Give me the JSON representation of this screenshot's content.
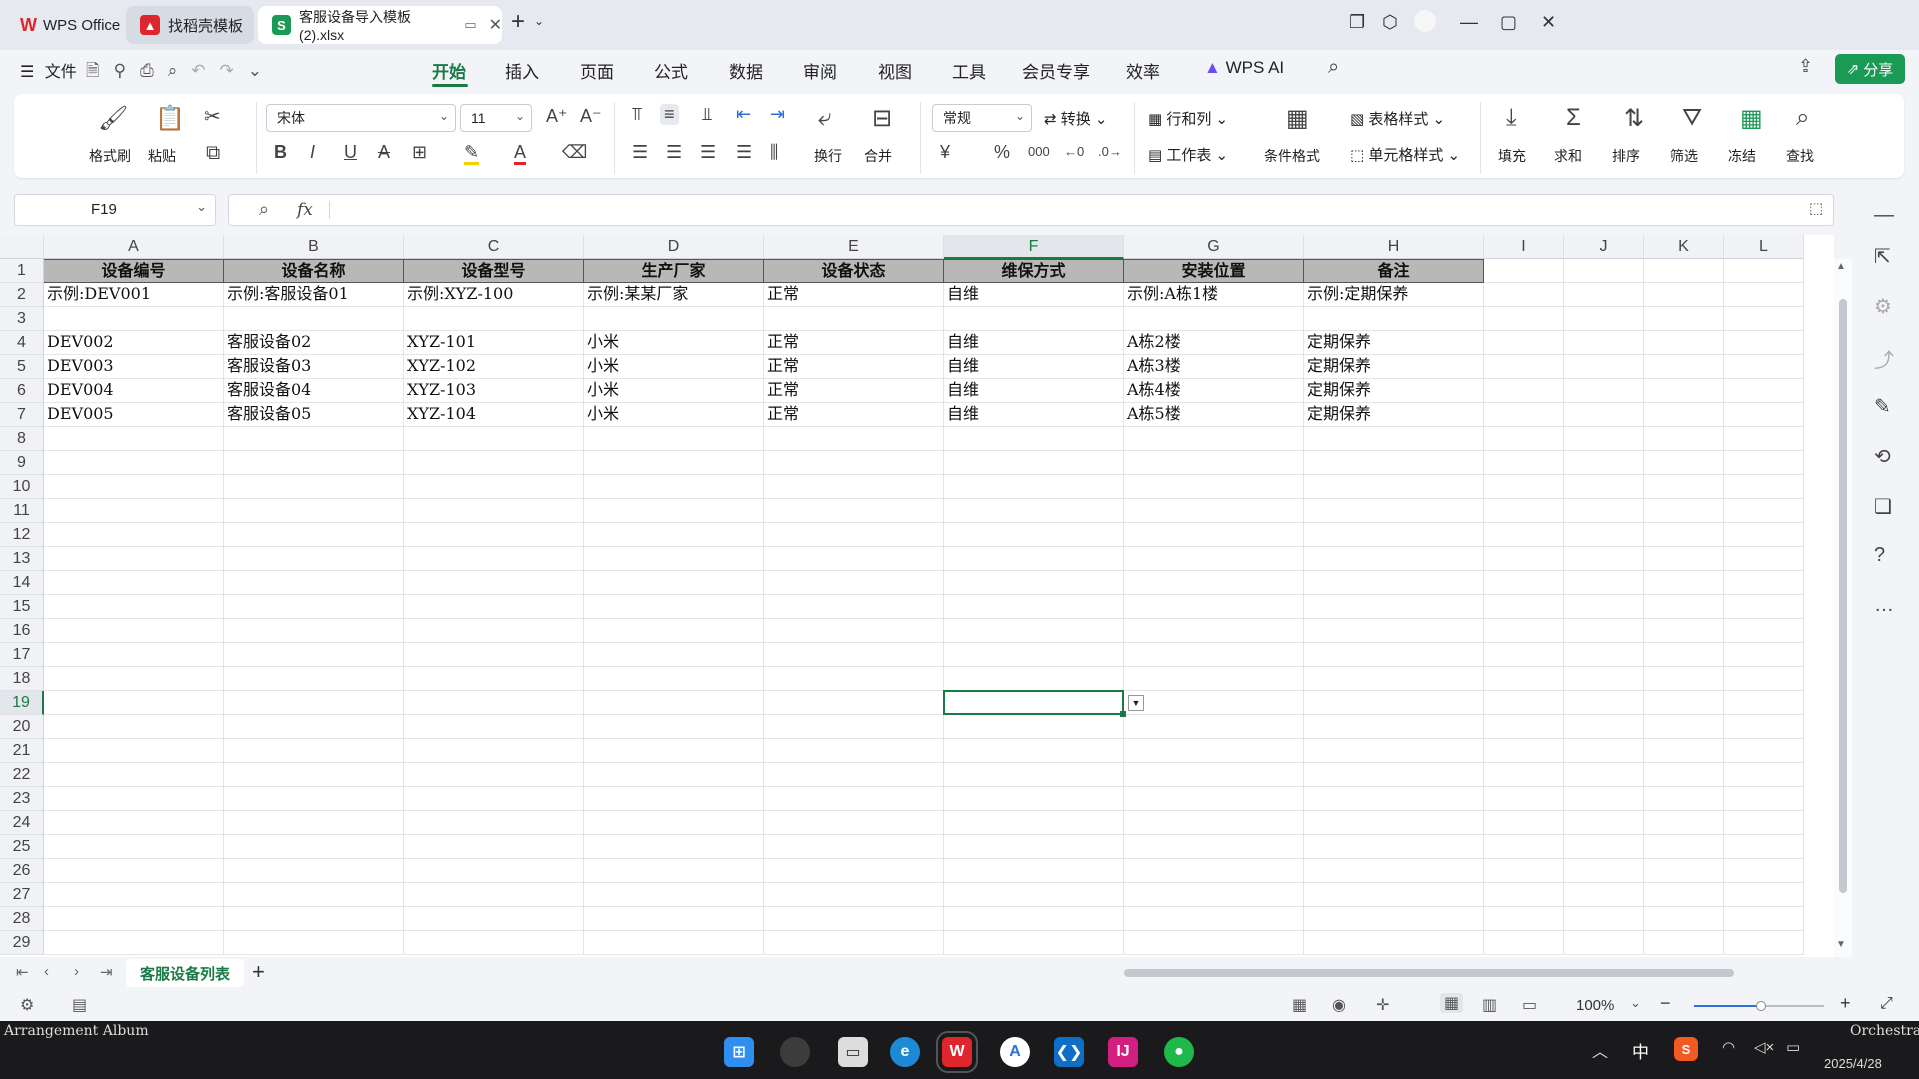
{
  "titlebar": {
    "tabs": [
      {
        "label": "WPS Office"
      },
      {
        "label": "找稻壳模板"
      },
      {
        "label": "客服设备导入模板 (2).xlsx"
      }
    ],
    "new_tab": "+"
  },
  "menubar": {
    "file": "文件",
    "items": [
      "开始",
      "插入",
      "页面",
      "公式",
      "数据",
      "审阅",
      "视图",
      "工具",
      "会员专享",
      "效率"
    ],
    "ai": "WPS AI",
    "share": "分享"
  },
  "ribbon": {
    "format_painter": "格式刷",
    "paste": "粘贴",
    "font_name": "宋体",
    "font_size": "11",
    "wrap": "换行",
    "merge": "合并",
    "number_format": "常规",
    "convert": "转换",
    "row_col": "行和列",
    "worksheet": "工作表",
    "cond_format": "条件格式",
    "table_style": "表格样式",
    "cell_style": "单元格样式",
    "fill": "填充",
    "sum": "求和",
    "sort": "排序",
    "filter": "筛选",
    "freeze": "冻结",
    "find": "查找",
    "currency": "¥",
    "percent": "%"
  },
  "formula_bar": {
    "name_box": "F19",
    "fx": "fx"
  },
  "columns": [
    "A",
    "B",
    "C",
    "D",
    "E",
    "F",
    "G",
    "H",
    "I",
    "J",
    "K",
    "L"
  ],
  "rows": [
    "1",
    "2",
    "3",
    "4",
    "5",
    "6",
    "7",
    "8",
    "9",
    "10",
    "11",
    "12",
    "13",
    "14",
    "15",
    "16",
    "17",
    "18",
    "19",
    "20",
    "21",
    "22",
    "23",
    "24",
    "25",
    "26",
    "27",
    "28",
    "29"
  ],
  "sheet": {
    "header": [
      "设备编号",
      "设备名称",
      "设备型号",
      "生产厂家",
      "设备状态",
      "维保方式",
      "安装位置",
      "备注"
    ],
    "example": [
      "示例:DEV001",
      "示例:客服设备01",
      "示例:XYZ-100",
      "示例:某某厂家",
      "正常",
      "自维",
      "示例:A栋1楼",
      "示例:定期保养"
    ],
    "data": [
      [
        "DEV002",
        "客服设备02",
        "XYZ-101",
        "小米",
        "正常",
        "自维",
        "A栋2楼",
        "定期保养"
      ],
      [
        "DEV003",
        "客服设备03",
        "XYZ-102",
        "小米",
        "正常",
        "自维",
        "A栋3楼",
        "定期保养"
      ],
      [
        "DEV004",
        "客服设备04",
        "XYZ-103",
        "小米",
        "正常",
        "自维",
        "A栋4楼",
        "定期保养"
      ],
      [
        "DEV005",
        "客服设备05",
        "XYZ-104",
        "小米",
        "正常",
        "自维",
        "A栋5楼",
        "定期保养"
      ]
    ],
    "selected_cell": "F19"
  },
  "sheet_tabs": {
    "active": "客服设备列表",
    "add": "+"
  },
  "statusbar": {
    "zoom": "100%"
  },
  "taskbar": {
    "media_left": "Arrangement Album",
    "media_right": "Orchestra",
    "ime": "中",
    "date": "2025/4/28"
  },
  "colors": {
    "accent_green": "#1a7a46",
    "header_fill": "#b8b8b8",
    "wps_red": "#e0262d"
  }
}
